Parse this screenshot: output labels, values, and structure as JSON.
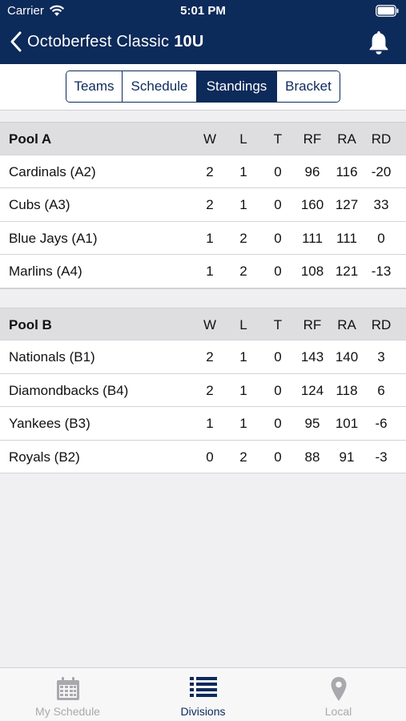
{
  "status_bar": {
    "carrier": "Carrier",
    "time": "5:01 PM"
  },
  "nav": {
    "title": "Octoberfest Classic",
    "division": "10U"
  },
  "segments": [
    {
      "label": "Teams",
      "active": false
    },
    {
      "label": "Schedule",
      "active": false
    },
    {
      "label": "Standings",
      "active": true
    },
    {
      "label": "Bracket",
      "active": false
    }
  ],
  "columns": [
    "W",
    "L",
    "T",
    "RF",
    "RA",
    "RD"
  ],
  "pools": [
    {
      "name": "Pool A",
      "rows": [
        {
          "team": "Cardinals (A2)",
          "w": "2",
          "l": "1",
          "t": "0",
          "rf": "96",
          "ra": "116",
          "rd": "-20"
        },
        {
          "team": "Cubs (A3)",
          "w": "2",
          "l": "1",
          "t": "0",
          "rf": "160",
          "ra": "127",
          "rd": "33"
        },
        {
          "team": "Blue Jays (A1)",
          "w": "1",
          "l": "2",
          "t": "0",
          "rf": "111",
          "ra": "111",
          "rd": "0"
        },
        {
          "team": "Marlins (A4)",
          "w": "1",
          "l": "2",
          "t": "0",
          "rf": "108",
          "ra": "121",
          "rd": "-13"
        }
      ]
    },
    {
      "name": "Pool B",
      "rows": [
        {
          "team": "Nationals (B1)",
          "w": "2",
          "l": "1",
          "t": "0",
          "rf": "143",
          "ra": "140",
          "rd": "3"
        },
        {
          "team": "Diamondbacks (B4)",
          "w": "2",
          "l": "1",
          "t": "0",
          "rf": "124",
          "ra": "118",
          "rd": "6"
        },
        {
          "team": "Yankees (B3)",
          "w": "1",
          "l": "1",
          "t": "0",
          "rf": "95",
          "ra": "101",
          "rd": "-6"
        },
        {
          "team": "Royals (B2)",
          "w": "0",
          "l": "2",
          "t": "0",
          "rf": "88",
          "ra": "91",
          "rd": "-3"
        }
      ]
    }
  ],
  "tabbar": [
    {
      "label": "My Schedule",
      "icon": "calendar-icon",
      "active": false
    },
    {
      "label": "Divisions",
      "icon": "list-icon",
      "active": true
    },
    {
      "label": "Local",
      "icon": "map-pin-icon",
      "active": false
    }
  ],
  "colors": {
    "primary": "#0c2a5a",
    "inactive_tab": "#a9a9ad"
  }
}
